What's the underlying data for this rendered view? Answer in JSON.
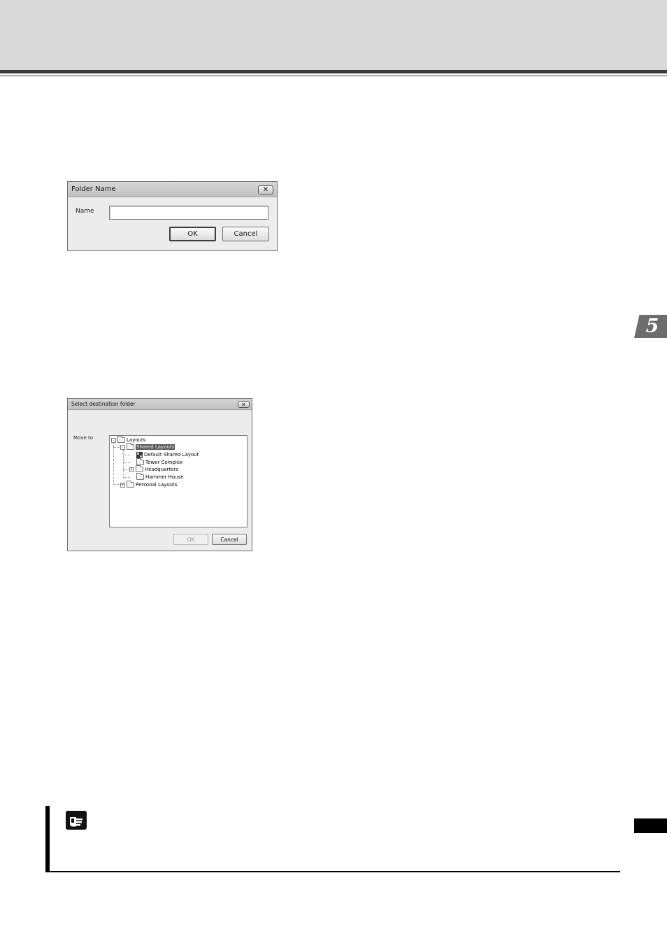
{
  "dialogs": {
    "folder_name": {
      "title": "Folder Name",
      "name_label": "Name",
      "name_value": "",
      "ok_label": "OK",
      "cancel_label": "Cancel",
      "close_glyph": "✕"
    },
    "select_destination": {
      "title": "Select destination folder",
      "move_to_label": "Move to",
      "close_glyph": "✕",
      "tree": {
        "root": "Layouts",
        "shared": "Shared Layouts",
        "default_shared": "Default Shared Layout",
        "tower": "Tower Complex",
        "headquarters": "Headquarters",
        "hammer": "Hammer House",
        "personal": "Personal Layouts"
      },
      "expanders": {
        "root": "-",
        "shared": "-",
        "headquarters": "+",
        "personal": "+"
      },
      "ok_label": "OK",
      "ok_enabled": false,
      "cancel_label": "Cancel"
    }
  },
  "chapter_tab": {
    "number": "5"
  },
  "icons": {
    "note": "pointing-hand-icon"
  },
  "colors": {
    "header_band": "#d9d9d9",
    "chapter_tab": "#6d6d6d",
    "selected_row": "#555555"
  }
}
